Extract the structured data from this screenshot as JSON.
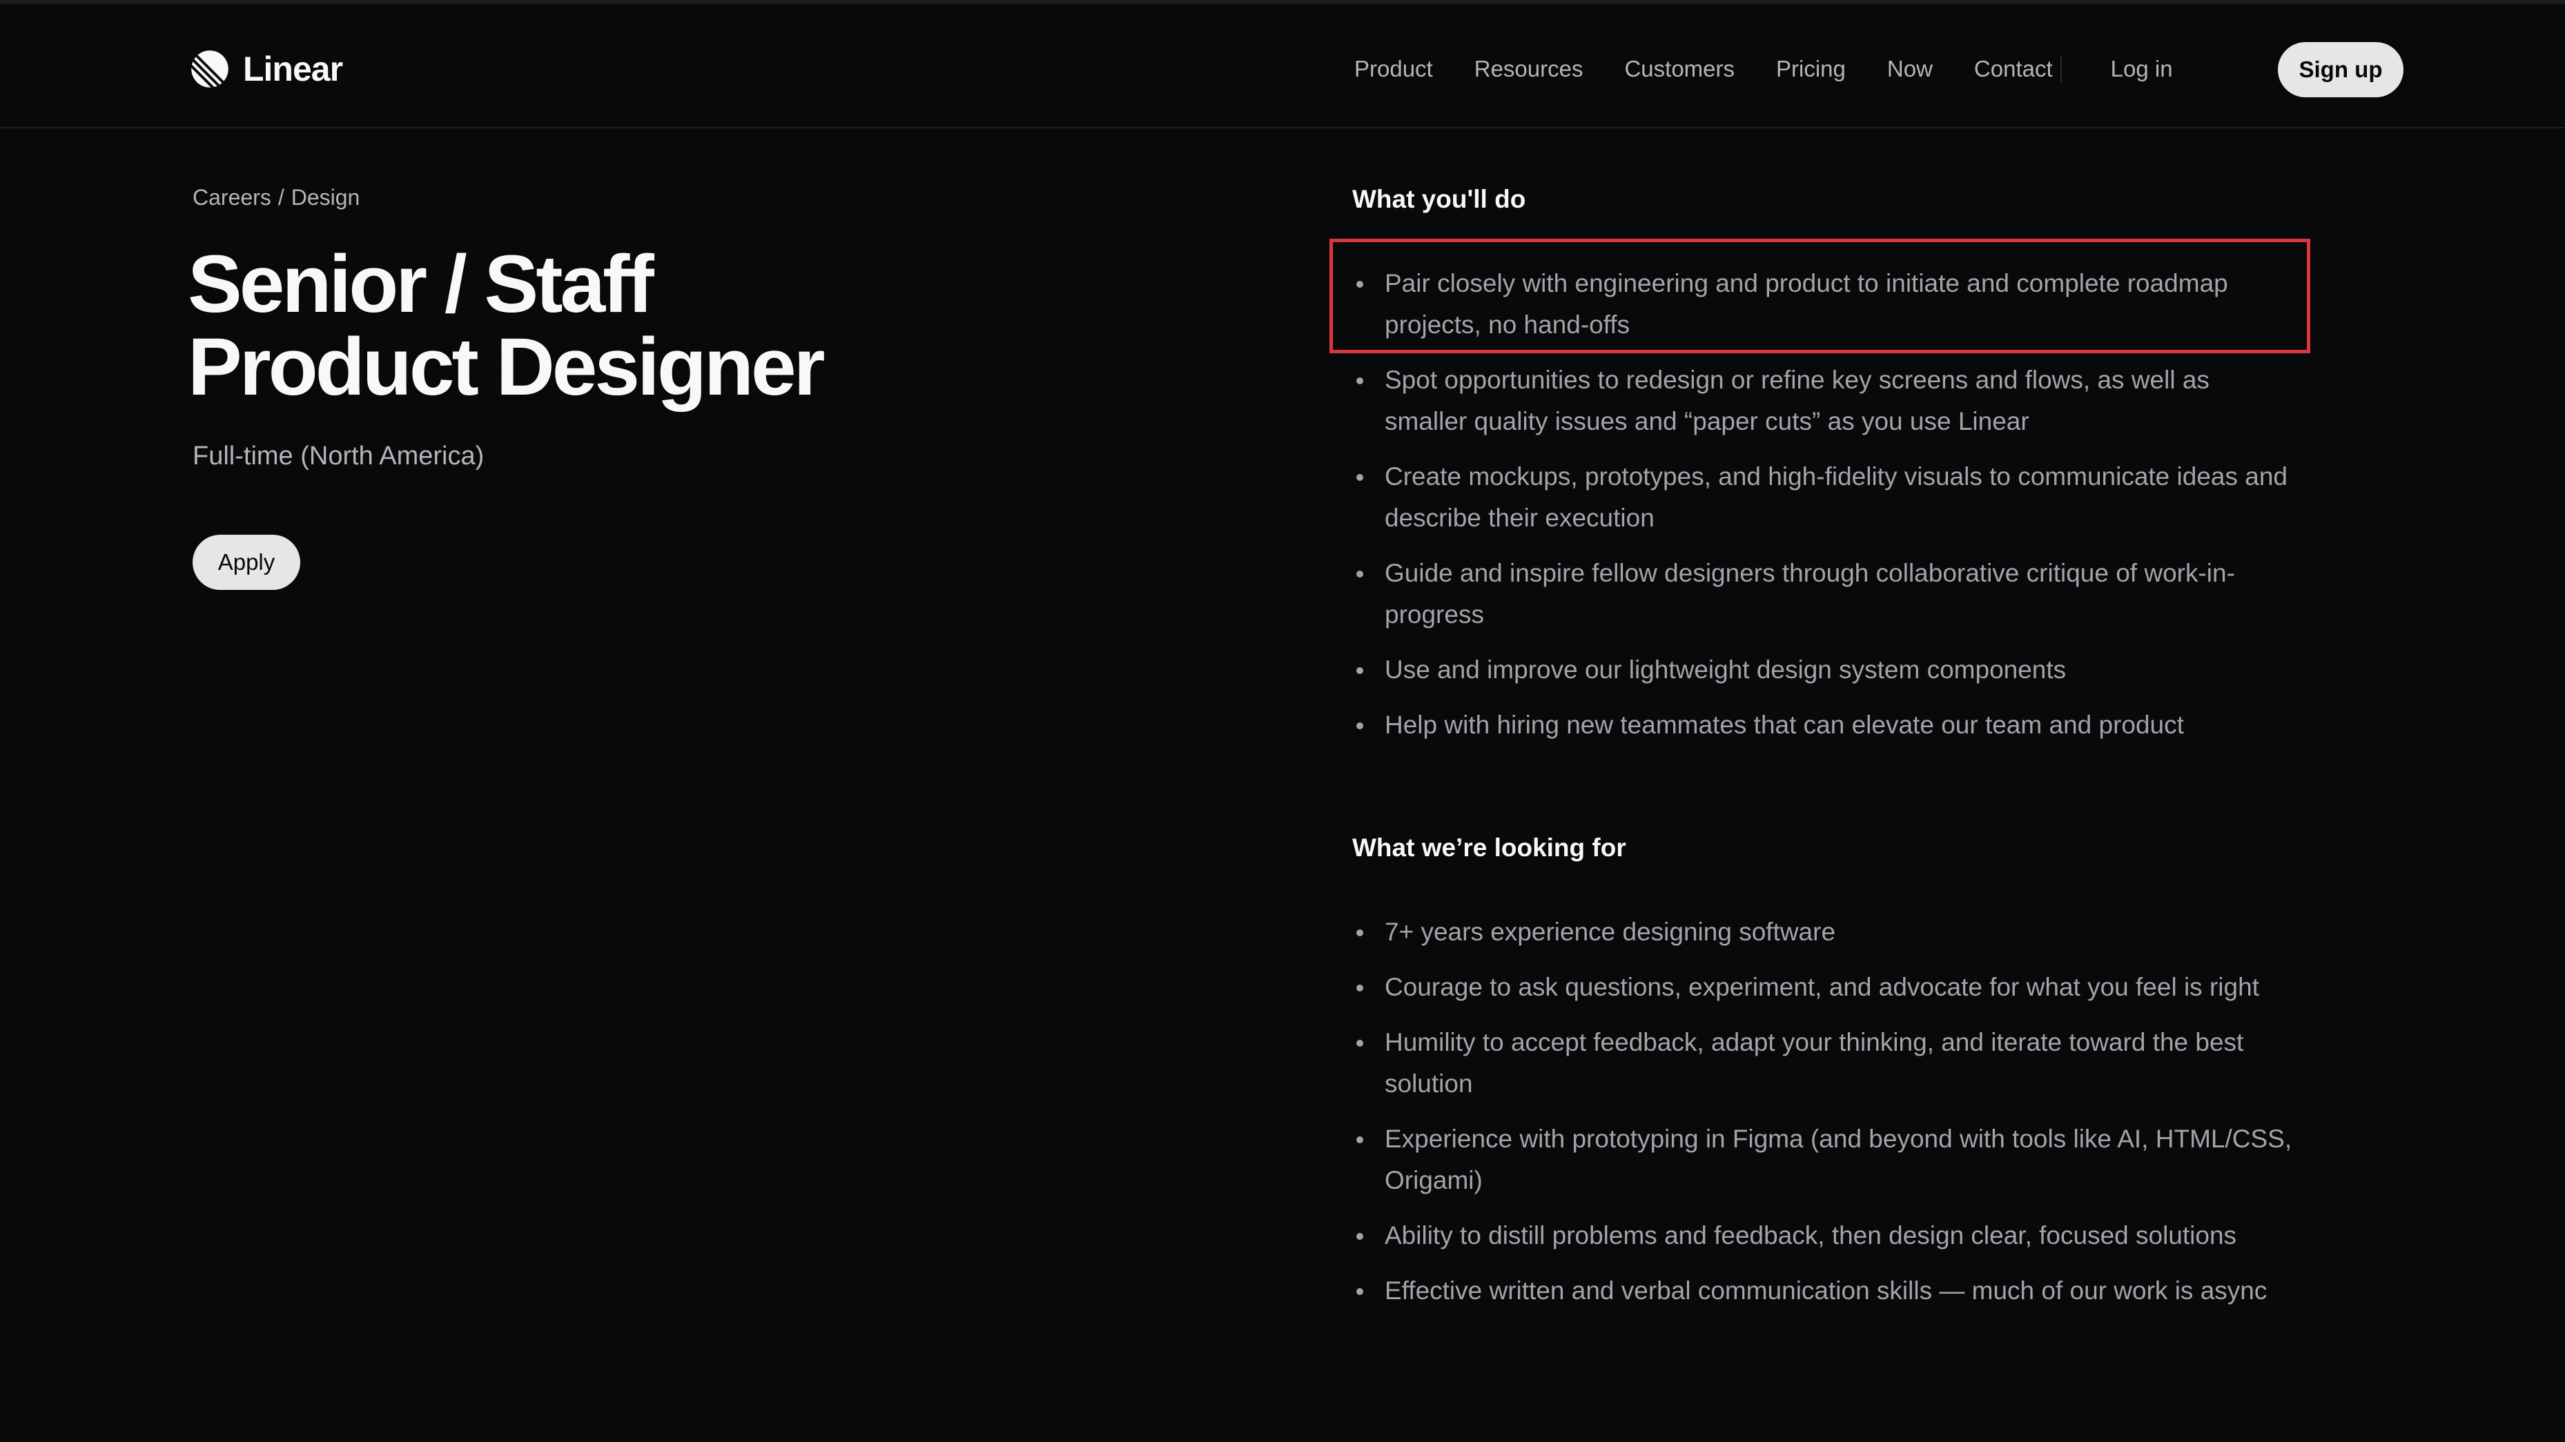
{
  "brand": {
    "name": "Linear"
  },
  "nav": {
    "links": [
      "Product",
      "Resources",
      "Customers",
      "Pricing",
      "Now",
      "Contact"
    ],
    "login": "Log in",
    "signup": "Sign up"
  },
  "breadcrumb": {
    "parent": "Careers",
    "separator": "/",
    "current": "Design"
  },
  "job": {
    "title_line1": "Senior / Staff",
    "title_line2": "Product Designer",
    "type": "Full-time (North America)",
    "apply_label": "Apply"
  },
  "sections": {
    "todo": {
      "heading": "What you'll do",
      "items": [
        "Pair closely with engineering and product to initiate and complete roadmap projects, no hand-offs",
        "Spot opportunities to redesign or refine key screens and flows, as well as smaller quality issues and “paper cuts” as you use Linear",
        "Create mockups, prototypes, and high-fidelity visuals to communicate ideas and describe their execution",
        "Guide and inspire fellow designers through collaborative critique of work-in-progress",
        "Use and improve our lightweight design system components",
        "Help with hiring new teammates that can elevate our team and product"
      ]
    },
    "looking": {
      "heading": "What we’re looking for",
      "items": [
        "7+ years experience designing software",
        "Courage to ask questions, experiment, and advocate for what you feel is right",
        "Humility to accept feedback, adapt your thinking, and iterate toward the best solution",
        "Experience with prototyping in Figma (and beyond with tools like AI, HTML/CSS, Origami)",
        "Ability to distill problems and feedback, then design clear, focused solutions",
        "Effective written and verbal communication skills — much of our work is async"
      ]
    }
  },
  "icons": {
    "logo": "linear-logo-icon",
    "bullet": "bullet-dot-icon"
  },
  "colors": {
    "background": "#08090a",
    "text_primary": "#f7f8f8",
    "text_secondary": "#a3a4a8",
    "button_bg": "#e6e6e6",
    "highlight_border": "#e0343f"
  }
}
